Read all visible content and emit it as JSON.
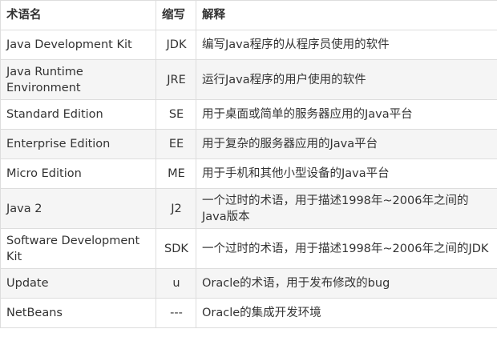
{
  "headers": {
    "term": "术语名",
    "abbr": "缩写",
    "desc": "解释"
  },
  "rows": [
    {
      "term": "Java Development Kit",
      "abbr": "JDK",
      "desc": "编写Java程序的从程序员使用的软件"
    },
    {
      "term": "Java Runtime Environment",
      "abbr": "JRE",
      "desc": "运行Java程序的用户使用的软件"
    },
    {
      "term": "Standard Edition",
      "abbr": "SE",
      "desc": "用于桌面或简单的服务器应用的Java平台"
    },
    {
      "term": "Enterprise Edition",
      "abbr": "EE",
      "desc": "用于复杂的服务器应用的Java平台"
    },
    {
      "term": "Micro Edition",
      "abbr": "ME",
      "desc": "用于手机和其他小型设备的Java平台"
    },
    {
      "term": "Java 2",
      "abbr": "J2",
      "desc": "一个过时的术语，用于描述1998年~2006年之间的Java版本"
    },
    {
      "term": "Software Development Kit",
      "abbr": "SDK",
      "desc": "一个过时的术语，用于描述1998年~2006年之间的JDK"
    },
    {
      "term": "Update",
      "abbr": "u",
      "desc": "Oracle的术语，用于发布修改的bug"
    },
    {
      "term": "NetBeans",
      "abbr": "---",
      "desc": "Oracle的集成开发环境"
    }
  ]
}
